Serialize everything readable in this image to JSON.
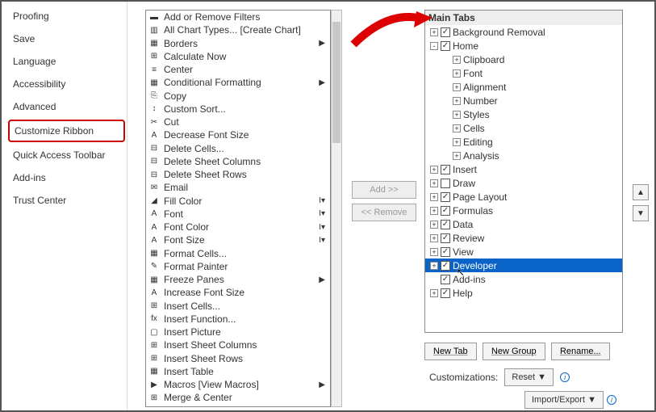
{
  "left_nav": {
    "items": [
      {
        "label": "Proofing"
      },
      {
        "label": "Save"
      },
      {
        "label": "Language"
      },
      {
        "label": "Accessibility"
      },
      {
        "label": "Advanced"
      },
      {
        "label": "Customize Ribbon",
        "highlighted": true
      },
      {
        "label": "Quick Access Toolbar"
      },
      {
        "label": "Add-ins"
      },
      {
        "label": "Trust Center"
      }
    ]
  },
  "commands": [
    {
      "label": "Add or Remove Filters"
    },
    {
      "label": "All Chart Types... [Create Chart]"
    },
    {
      "label": "Borders",
      "submenu": true
    },
    {
      "label": "Calculate Now"
    },
    {
      "label": "Center"
    },
    {
      "label": "Conditional Formatting",
      "submenu": true
    },
    {
      "label": "Copy"
    },
    {
      "label": "Custom Sort..."
    },
    {
      "label": "Cut"
    },
    {
      "label": "Decrease Font Size"
    },
    {
      "label": "Delete Cells..."
    },
    {
      "label": "Delete Sheet Columns"
    },
    {
      "label": "Delete Sheet Rows"
    },
    {
      "label": "Email"
    },
    {
      "label": "Fill Color",
      "dropdown": true
    },
    {
      "label": "Font",
      "dropdown": true
    },
    {
      "label": "Font Color",
      "dropdown": true
    },
    {
      "label": "Font Size",
      "dropdown": true
    },
    {
      "label": "Format Cells..."
    },
    {
      "label": "Format Painter"
    },
    {
      "label": "Freeze Panes",
      "submenu": true
    },
    {
      "label": "Increase Font Size"
    },
    {
      "label": "Insert Cells..."
    },
    {
      "label": "Insert Function..."
    },
    {
      "label": "Insert Picture"
    },
    {
      "label": "Insert Sheet Columns"
    },
    {
      "label": "Insert Sheet Rows"
    },
    {
      "label": "Insert Table"
    },
    {
      "label": "Macros [View Macros]",
      "submenu": true
    },
    {
      "label": "Merge & Center"
    }
  ],
  "mid": {
    "add": "Add >>",
    "remove": "<< Remove"
  },
  "right": {
    "header": "Main Tabs",
    "tree": [
      {
        "indent": 0,
        "pm": "+",
        "chk": true,
        "label": "Background Removal"
      },
      {
        "indent": 0,
        "pm": "-",
        "chk": true,
        "label": "Home"
      },
      {
        "indent": 1,
        "pm": "+",
        "label": "Clipboard"
      },
      {
        "indent": 1,
        "pm": "+",
        "label": "Font"
      },
      {
        "indent": 1,
        "pm": "+",
        "label": "Alignment"
      },
      {
        "indent": 1,
        "pm": "+",
        "label": "Number"
      },
      {
        "indent": 1,
        "pm": "+",
        "label": "Styles"
      },
      {
        "indent": 1,
        "pm": "+",
        "label": "Cells"
      },
      {
        "indent": 1,
        "pm": "+",
        "label": "Editing"
      },
      {
        "indent": 1,
        "pm": "+",
        "label": "Analysis"
      },
      {
        "indent": 0,
        "pm": "+",
        "chk": true,
        "label": "Insert"
      },
      {
        "indent": 0,
        "pm": "+",
        "chk": false,
        "label": "Draw"
      },
      {
        "indent": 0,
        "pm": "+",
        "chk": true,
        "label": "Page Layout"
      },
      {
        "indent": 0,
        "pm": "+",
        "chk": true,
        "label": "Formulas"
      },
      {
        "indent": 0,
        "pm": "+",
        "chk": true,
        "label": "Data"
      },
      {
        "indent": 0,
        "pm": "+",
        "chk": true,
        "label": "Review"
      },
      {
        "indent": 0,
        "pm": "+",
        "chk": true,
        "label": "View"
      },
      {
        "indent": 0,
        "pm": "+",
        "chk": true,
        "label": "Developer",
        "selected": true,
        "cursor": true
      },
      {
        "indent": 0,
        "pm": "",
        "chk": true,
        "label": "Add-ins"
      },
      {
        "indent": 0,
        "pm": "+",
        "chk": true,
        "label": "Help"
      }
    ]
  },
  "bottom": {
    "new_tab": "New Tab",
    "new_group": "New Group",
    "rename": "Rename...",
    "customizations_label": "Customizations:",
    "reset": "Reset ▼",
    "import_export": "Import/Export ▼"
  }
}
